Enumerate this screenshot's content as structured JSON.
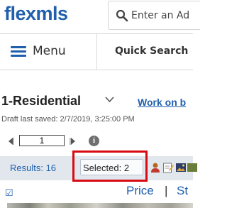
{
  "header": {
    "logo_text": "flexmls",
    "search_placeholder": "Enter an Ad"
  },
  "nav": {
    "menu_label": "Menu",
    "quick_search_label": "Quick Search"
  },
  "search_view": {
    "title": "1-Residential",
    "work_on_link": "Work on b",
    "draft_saved": "Draft last saved: 2/7/2019, 3:25:00 PM"
  },
  "pager": {
    "page_value": "1",
    "prev_glyph": "◀",
    "next_glyph": "▶",
    "info_glyph": "i"
  },
  "toolbar": {
    "results_label": "Results: 16",
    "selected_label": "Selected: 2"
  },
  "columns": {
    "checkbox_glyph": "☑",
    "price": "Price",
    "separator": "|",
    "status": "St"
  },
  "colors": {
    "brand_blue": "#1f5fad",
    "highlight_red": "#d80a14",
    "toolbar_bg": "#e2e7ee"
  }
}
